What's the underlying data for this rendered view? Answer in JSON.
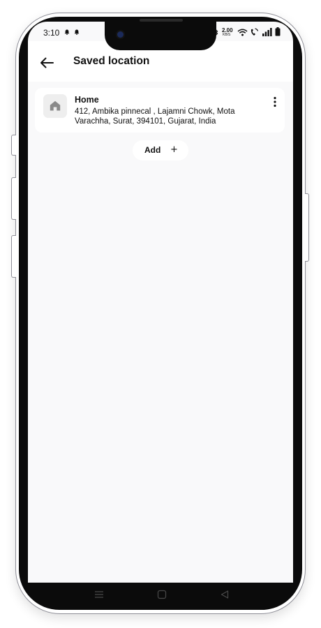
{
  "status_bar": {
    "time": "3:10",
    "network_speed_value": "2.00",
    "network_speed_unit": "KB/S"
  },
  "header": {
    "title": "Saved location"
  },
  "saved_locations": [
    {
      "name": "Home",
      "address": "412, Ambika pinnecal , Lajamni Chowk, Mota Varachha, Surat, 394101, Gujarat, India",
      "icon": "home-icon"
    }
  ],
  "add_button": {
    "label": "Add",
    "icon": "+"
  },
  "icons": {
    "back": "arrow-left-icon",
    "more": "more-vertical-icon",
    "nav": [
      "menu-icon",
      "home-square-icon",
      "back-triangle-icon"
    ]
  },
  "colors": {
    "screen_background": "#f9f9fa",
    "card_background": "#ffffff",
    "icon_box_background": "#eeeeee",
    "icon_color": "#8a8a8a",
    "text_color": "#111111"
  }
}
